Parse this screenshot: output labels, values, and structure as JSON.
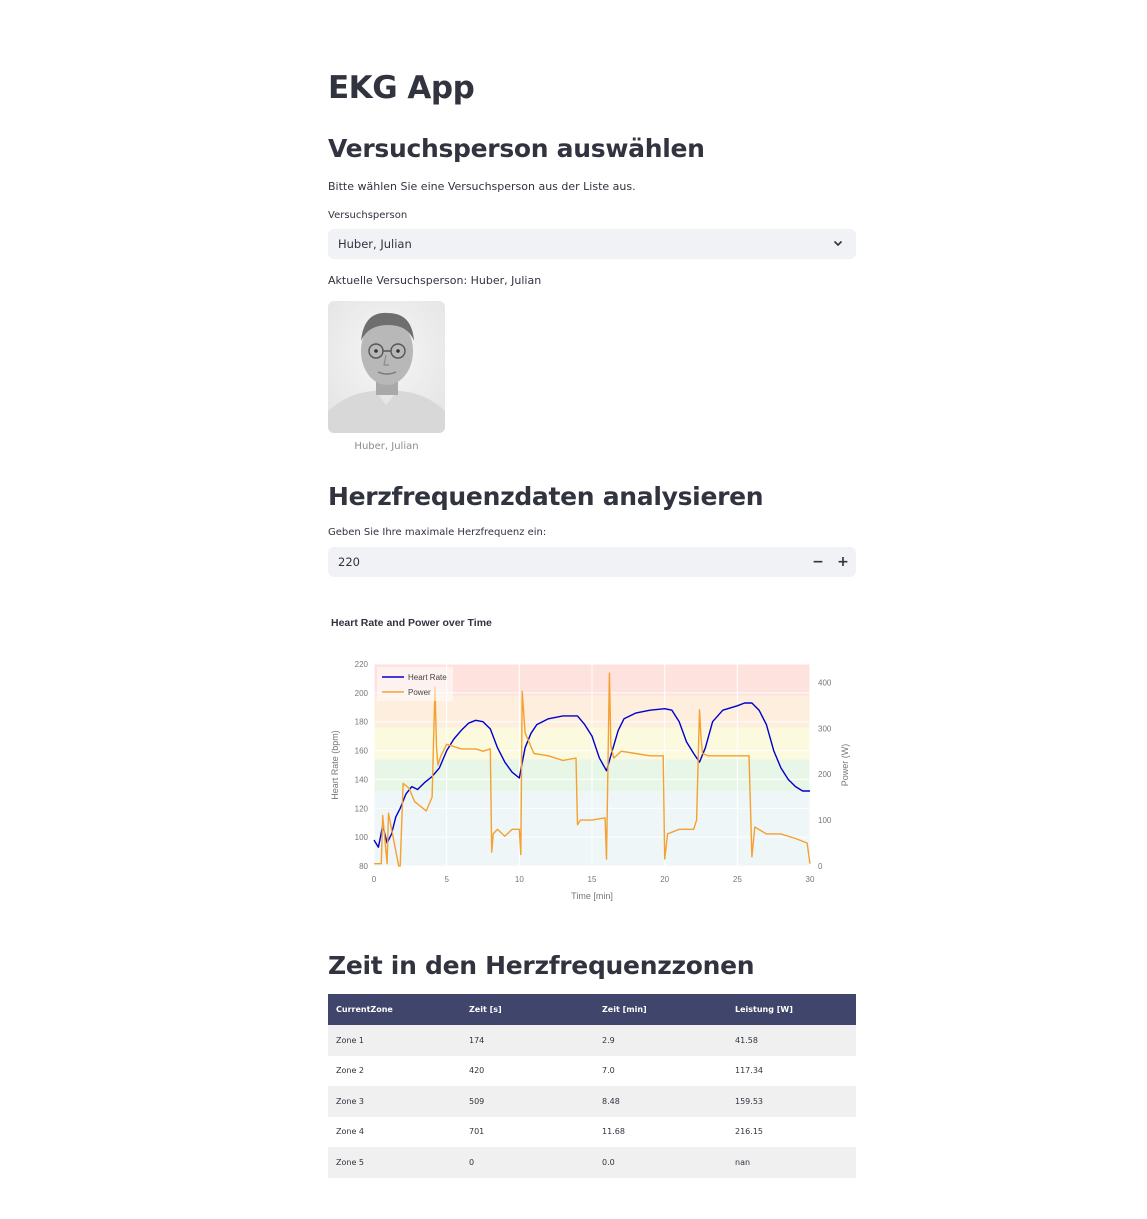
{
  "app": {
    "title": "EKG App"
  },
  "person_section": {
    "heading": "Versuchsperson auswählen",
    "instruction": "Bitte wählen Sie eine Versuchsperson aus der Liste aus.",
    "select_label": "Versuchsperson",
    "select_value": "Huber, Julian",
    "current_text": "Aktuelle Versuchsperson: Huber, Julian",
    "photo_caption": "Huber, Julian"
  },
  "hr_section": {
    "heading": "Herzfrequenzdaten analysieren",
    "input_label": "Geben Sie Ihre maximale Herzfrequenz ein:",
    "input_value": "220",
    "minus": "−",
    "plus": "+"
  },
  "chart_data": {
    "type": "line",
    "title": "Heart Rate and Power over Time",
    "xlabel": "Time [min]",
    "ylabel": "Heart Rate (bpm)",
    "y2label": "Power (W)",
    "xlim": [
      0,
      30
    ],
    "ylim": [
      80,
      220
    ],
    "y2lim": [
      0,
      440
    ],
    "xticks": [
      0,
      5,
      10,
      15,
      20,
      25,
      30
    ],
    "yticks": [
      80,
      100,
      120,
      140,
      160,
      180,
      200,
      220
    ],
    "y2ticks": [
      0,
      100,
      200,
      300,
      400
    ],
    "legend_position": "top-left",
    "zone_bands": [
      {
        "from": 80,
        "to": 132,
        "color": "#eef6f7"
      },
      {
        "from": 132,
        "to": 154,
        "color": "#e8f6e8"
      },
      {
        "from": 154,
        "to": 176,
        "color": "#fbf9de"
      },
      {
        "from": 176,
        "to": 198,
        "color": "#fdeede"
      },
      {
        "from": 198,
        "to": 220,
        "color": "#fde2de"
      }
    ],
    "series": [
      {
        "name": "Heart Rate",
        "axis": "y",
        "color": "#0000cc",
        "x": [
          0,
          0.3,
          0.6,
          0.9,
          1.2,
          1.5,
          1.8,
          2.2,
          2.6,
          3.0,
          3.5,
          4.0,
          4.5,
          5.0,
          5.5,
          6.0,
          6.5,
          7.0,
          7.5,
          8.0,
          8.5,
          9.0,
          9.5,
          10.0,
          10.4,
          10.8,
          11.2,
          12.0,
          13.0,
          14.0,
          14.5,
          15.0,
          15.5,
          16.0,
          16.4,
          16.8,
          17.2,
          18.0,
          19.0,
          20.0,
          20.5,
          21.0,
          21.5,
          22.0,
          22.4,
          22.8,
          23.3,
          24.0,
          25.0,
          25.5,
          26.0,
          26.5,
          27.0,
          27.5,
          28.0,
          28.5,
          29.0,
          29.5,
          30.0
        ],
        "y": [
          98,
          93,
          108,
          96,
          102,
          114,
          120,
          130,
          135,
          133,
          138,
          142,
          148,
          160,
          168,
          174,
          179,
          181,
          180,
          175,
          162,
          152,
          145,
          141,
          162,
          172,
          178,
          182,
          184,
          184,
          178,
          170,
          155,
          146,
          160,
          174,
          182,
          186,
          188,
          189,
          188,
          180,
          166,
          158,
          152,
          162,
          180,
          188,
          191,
          193,
          193,
          188,
          178,
          160,
          148,
          140,
          135,
          132,
          132
        ]
      },
      {
        "name": "Power",
        "axis": "y2",
        "color": "#f5a030",
        "x": [
          0,
          0.5,
          0.6,
          0.9,
          1.0,
          1.7,
          1.8,
          2.0,
          2.4,
          2.8,
          3.2,
          3.6,
          4.0,
          4.2,
          4.3,
          4.4,
          4.6,
          5.0,
          5.5,
          6.0,
          7.0,
          7.5,
          8.0,
          8.1,
          8.2,
          8.5,
          9.0,
          9.5,
          10.0,
          10.1,
          10.2,
          10.4,
          11.0,
          12.0,
          13.0,
          13.9,
          14.0,
          14.2,
          15.0,
          15.9,
          16.0,
          16.2,
          16.3,
          16.5,
          17.0,
          18.0,
          19.0,
          19.9,
          20.0,
          20.2,
          21.0,
          22.0,
          22.2,
          22.4,
          22.5,
          22.6,
          23.0,
          24.0,
          25.0,
          25.8,
          26.0,
          26.2,
          27.0,
          28.0,
          29.0,
          29.8,
          30.0
        ],
        "y": [
          5,
          5,
          110,
          5,
          115,
          0,
          0,
          180,
          170,
          140,
          130,
          120,
          150,
          390,
          260,
          220,
          240,
          265,
          260,
          255,
          255,
          250,
          255,
          30,
          70,
          80,
          65,
          80,
          80,
          25,
          380,
          290,
          245,
          240,
          230,
          235,
          90,
          100,
          100,
          105,
          15,
          420,
          260,
          235,
          250,
          245,
          240,
          240,
          15,
          70,
          80,
          80,
          100,
          340,
          280,
          245,
          240,
          240,
          240,
          240,
          20,
          85,
          70,
          70,
          60,
          50,
          5
        ]
      }
    ]
  },
  "zones_section": {
    "heading": "Zeit in den Herzfrequenzzonen",
    "columns": [
      "CurrentZone",
      "Zeit [s]",
      "Zeit [min]",
      "Leistung [W]"
    ],
    "rows": [
      [
        "Zone 1",
        "174",
        "2.9",
        "41.58"
      ],
      [
        "Zone 2",
        "420",
        "7.0",
        "117.34"
      ],
      [
        "Zone 3",
        "509",
        "8.48",
        "159.53"
      ],
      [
        "Zone 4",
        "701",
        "11.68",
        "216.15"
      ],
      [
        "Zone 5",
        "0",
        "0.0",
        "nan"
      ]
    ]
  }
}
